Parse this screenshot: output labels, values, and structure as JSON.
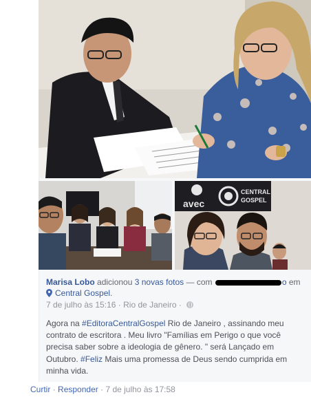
{
  "post": {
    "author": "Marisa Lobo",
    "action_text": "adicionou",
    "photos_link": "3 novas fotos",
    "with_text": "— com",
    "tagged_suffix": "o",
    "in_text": "em",
    "page_name": "Central Gospel",
    "date": "7 de julho às 15:16",
    "separator": "·",
    "location": "Rio de Janeiro",
    "dot": "·",
    "text_parts": {
      "p1": "Agora na ",
      "tag1": "#EditoraCentralGospel",
      "p2": " Rio de Janeiro , assinando meu contrato de escritora . Meu livro \"Famílias em Perigo o que você precisa saber sobre a ideologia de gênero. \" será Lançado em Outubro. ",
      "tag2": "#Feliz",
      "p3": " Mais uma promessa de Deus sendo cumprida em minha vida."
    }
  },
  "photos": {
    "main_alt": "Pessoas assinando contrato",
    "left_alt": "Selfie em grupo",
    "right_alt": "Selfie em frente ao logo",
    "logo_avec": "avec",
    "logo_central": "CENTRAL",
    "logo_gospel": "GOSPEL"
  },
  "comment_actions": {
    "like": "Curtir",
    "sep1": "·",
    "reply": "Responder",
    "sep2": "·",
    "timestamp": "7 de julho às 17:58"
  },
  "colors": {
    "link": "#365899",
    "muted": "#90949c"
  }
}
